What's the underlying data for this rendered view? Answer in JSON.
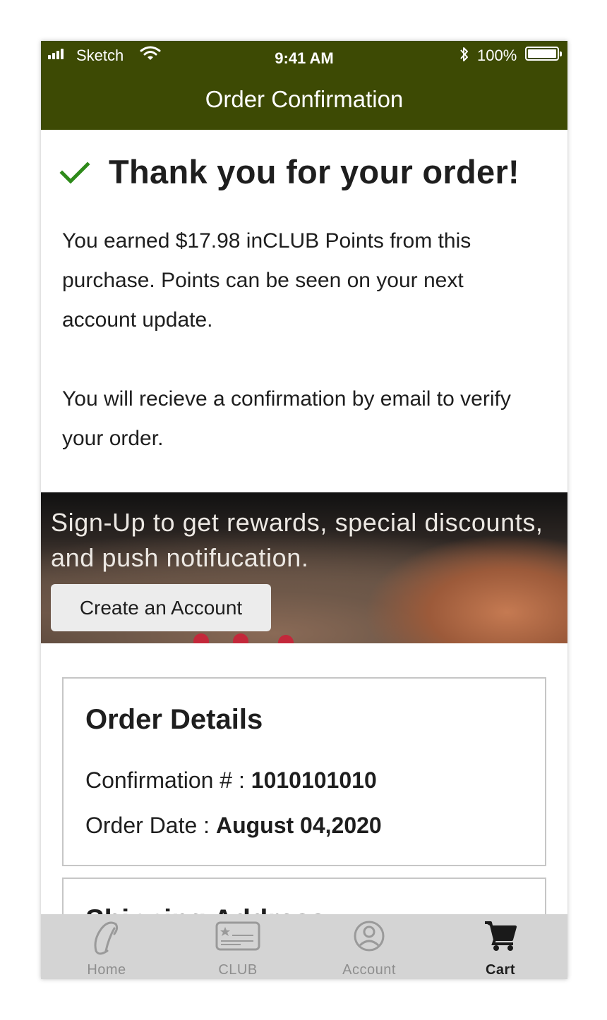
{
  "status_bar": {
    "carrier": "Sketch",
    "time": "9:41 AM",
    "battery": "100%"
  },
  "header": {
    "title": "Order Confirmation"
  },
  "thank_you": {
    "heading": "Thank you for your order!",
    "paragraph_1": "You earned $17.98 inCLUB Points from this purchase. Points can be seen on your next account update.",
    "paragraph_2": "You will recieve a confirmation by email to verify your order."
  },
  "banner": {
    "text": "Sign-Up to get rewards, special discounts, and push notifucation.",
    "button_label": "Create an Account"
  },
  "order_details": {
    "title": "Order Details",
    "confirmation_label": "Confirmation # : ",
    "confirmation_value": "1010101010",
    "date_label": "Order Date : ",
    "date_value": "August 04,2020"
  },
  "shipping": {
    "title": "Shipping Address"
  },
  "tabs": [
    {
      "label": "Home",
      "icon": "home-logo-icon",
      "active": false
    },
    {
      "label": "CLUB",
      "icon": "club-card-icon",
      "active": false
    },
    {
      "label": "Account",
      "icon": "account-icon",
      "active": false
    },
    {
      "label": "Cart",
      "icon": "cart-icon",
      "active": true
    }
  ],
  "colors": {
    "header_bg": "#3d4a04",
    "check": "#2e8a1a",
    "tabbar_bg": "#d4d4d4"
  }
}
